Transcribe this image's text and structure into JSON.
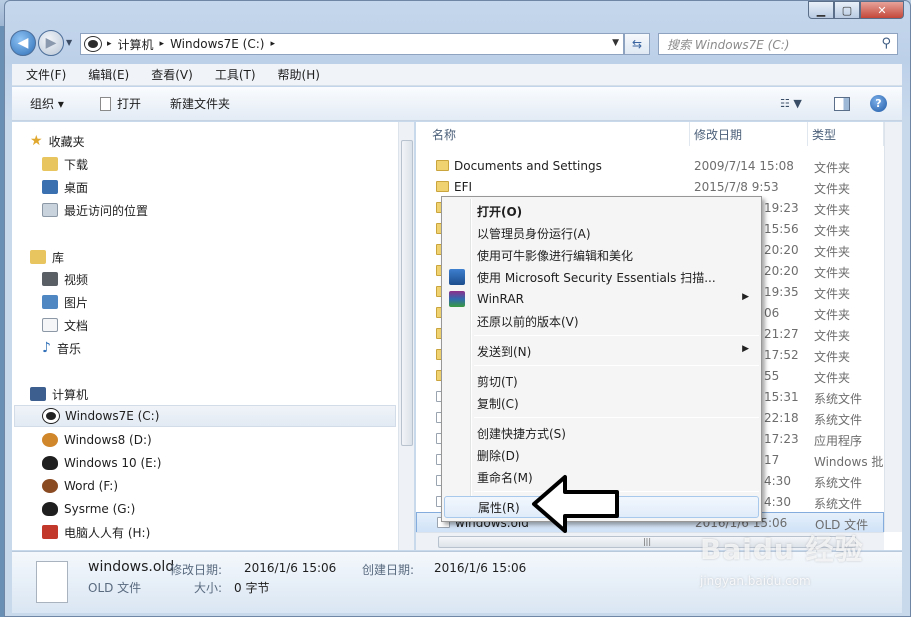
{
  "window": {
    "caption_min": "▁",
    "caption_max": "▢",
    "caption_close": "✕"
  },
  "address": {
    "segments": [
      "计算机",
      "Windows7E (C:)"
    ],
    "sep": "▸",
    "search_placeholder": "搜索 Windows7E (C:)"
  },
  "menubar": {
    "items": [
      "文件(F)",
      "编辑(E)",
      "查看(V)",
      "工具(T)",
      "帮助(H)"
    ]
  },
  "toolbar": {
    "organize": "组织 ▾",
    "open": "打开",
    "new_folder": "新建文件夹",
    "help": "?"
  },
  "nav": {
    "favorites": "收藏夹",
    "downloads": "下载",
    "desktop": "桌面",
    "recent": "最近访问的位置",
    "libraries": "库",
    "videos": "视频",
    "pictures": "图片",
    "documents": "文档",
    "music": "音乐",
    "computer": "计算机",
    "drives": [
      "Windows7E (C:)",
      "Windows8 (D:)",
      "Windows 10 (E:)",
      "Word (F:)",
      "Sysrme (G:)",
      "电脑人人有 (H:)"
    ]
  },
  "columns": {
    "name": "名称",
    "date": "修改日期",
    "type": "类型"
  },
  "files": [
    {
      "name": "Documents and Settings",
      "date": "2009/7/14 15:08",
      "type": "文件夹"
    },
    {
      "name": "EFI",
      "date": "2015/7/8 9:53",
      "type": "文件夹"
    },
    {
      "name": "",
      "date": "19:23",
      "type": "文件夹"
    },
    {
      "name": "",
      "date": "15:56",
      "type": "文件夹"
    },
    {
      "name": "",
      "date": "20:20",
      "type": "文件夹"
    },
    {
      "name": "",
      "date": "20:20",
      "type": "文件夹"
    },
    {
      "name": "",
      "date": "19:35",
      "type": "文件夹"
    },
    {
      "name": "",
      "date": "06",
      "type": "文件夹"
    },
    {
      "name": "",
      "date": "21:27",
      "type": "文件夹"
    },
    {
      "name": "",
      "date": "17:52",
      "type": "文件夹"
    },
    {
      "name": "",
      "date": "55",
      "type": "文件夹"
    },
    {
      "name": "",
      "date": "15:31",
      "type": "系统文件"
    },
    {
      "name": "",
      "date": "22:18",
      "type": "系统文件"
    },
    {
      "name": "",
      "date": "17:23",
      "type": "应用程序"
    },
    {
      "name": "",
      "date": "17",
      "type": "Windows 批"
    },
    {
      "name": "",
      "date": "4:30",
      "type": "系统文件"
    },
    {
      "name": "",
      "date": "4:30",
      "type": "系统文件"
    },
    {
      "name": "windows.old",
      "date": "2016/1/6 15:06",
      "type": "OLD 文件"
    }
  ],
  "context_menu": {
    "open": "打开(O)",
    "run_as_admin": "以管理员身份运行(A)",
    "keniu": "使用可牛影像进行编辑和美化",
    "mse": "使用 Microsoft Security Essentials 扫描...",
    "winrar": "WinRAR",
    "restore": "还原以前的版本(V)",
    "send_to": "发送到(N)",
    "cut": "剪切(T)",
    "copy": "复制(C)",
    "shortcut": "创建快捷方式(S)",
    "delete": "删除(D)",
    "rename": "重命名(M)",
    "properties": "属性(R)",
    "submenu_arrow": "▶"
  },
  "details": {
    "name": "windows.old",
    "type": "OLD 文件",
    "modified_label": "修改日期:",
    "modified": "2016/1/6 15:06",
    "size_label": "大小:",
    "size": "0 字节",
    "created_label": "创建日期:",
    "created": "2016/1/6 15:06"
  },
  "watermark": {
    "brand": "Baidu 经验",
    "url": "jingyan.baidu.com"
  },
  "colors": {
    "accent": "#2f6fb7",
    "selection": "#cfe2f7",
    "menu_bg": "#f5f5f5"
  }
}
